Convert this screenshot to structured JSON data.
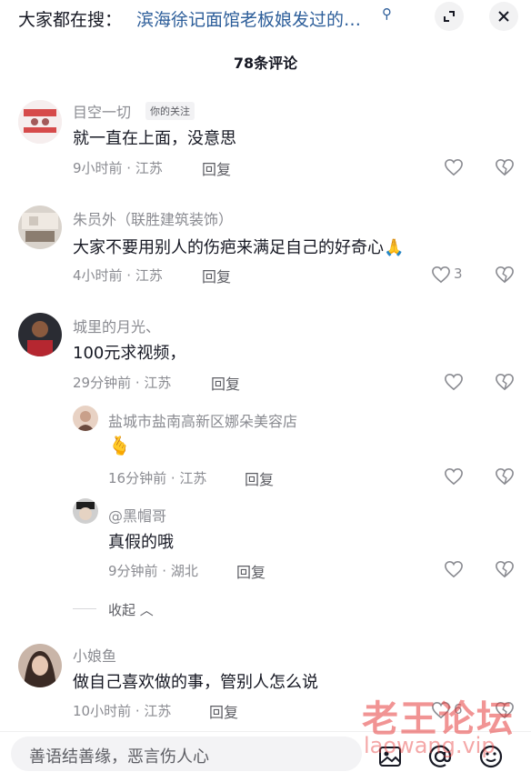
{
  "search_bar": {
    "prefix": "大家都在搜：",
    "query": "滨海徐记面馆老板娘发过的…"
  },
  "header": {
    "title": "78条评论"
  },
  "comments": [
    {
      "username": "目空一切",
      "tag": "你的关注",
      "text": "就一直在上面，没意思",
      "meta": "9小时前 · 江苏",
      "reply": "回复",
      "likes": ""
    },
    {
      "username": "朱员外（联胜建筑装饰）",
      "text": "大家不要用别人的伤疤来满足自己的好奇心",
      "emoji": "🙏",
      "meta": "4小时前 · 江苏",
      "reply": "回复",
      "likes": "3"
    },
    {
      "username": "城里的月光、",
      "text": "100元求视频，",
      "meta": "29分钟前 · 江苏",
      "reply": "回复",
      "likes": ""
    }
  ],
  "replies": [
    {
      "username": "盐城市盐南高新区娜朵美容店",
      "emoji": "🫰",
      "meta": "16分钟前 · 江苏",
      "reply": "回复"
    },
    {
      "username": "@黑帽哥",
      "text": "真假的哦",
      "meta": "9分钟前 · 湖北",
      "reply": "回复"
    }
  ],
  "collapse_label": "收起",
  "last_comment": {
    "username": "小娘鱼",
    "text": "做自己喜欢做的事，管别人怎么说",
    "meta": "10小时前 · 江苏",
    "reply": "回复",
    "likes": "6"
  },
  "input": {
    "placeholder": "善语结善缘，恶言伤人心"
  },
  "watermark": {
    "text": "老王论坛",
    "url": "laowang.vip"
  }
}
